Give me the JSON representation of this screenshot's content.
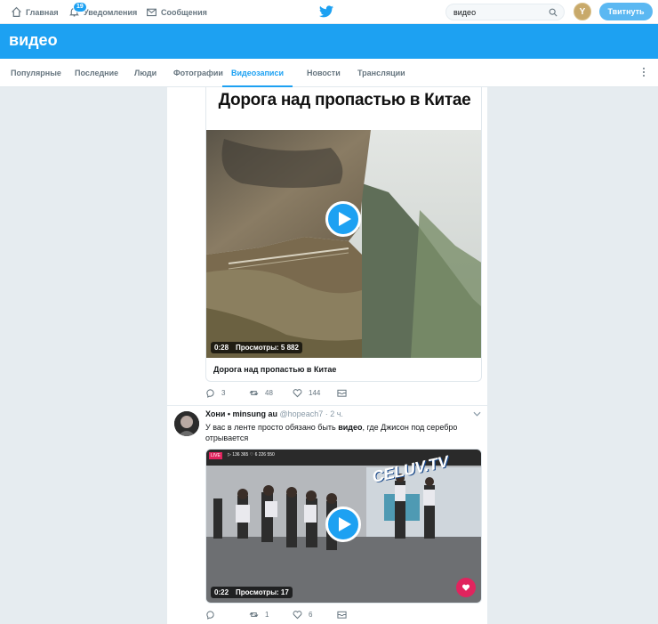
{
  "topnav": {
    "home_label": "Главная",
    "notifications_label": "Уведомления",
    "notifications_count": "19",
    "messages_label": "Сообщения",
    "search_value": "видео",
    "avatar_letter": "Y",
    "tweet_button_label": "Твитнуть"
  },
  "banner": {
    "title": "видео"
  },
  "tabs": [
    {
      "label": "Популярные"
    },
    {
      "label": "Последние"
    },
    {
      "label": "Люди"
    },
    {
      "label": "Фотографии"
    },
    {
      "label": "Видеозаписи",
      "active": true
    },
    {
      "label": "Новости"
    },
    {
      "label": "Трансляции"
    }
  ],
  "tweet1": {
    "card_heading": "Дорога над пропастью в Китае",
    "duration": "0:28",
    "views": "Просмотры: 5 882",
    "caption": "Дорога над пропастью в Китае",
    "replies": "3",
    "retweets": "48",
    "likes": "144"
  },
  "tweet2": {
    "name": "Хони • minsung au",
    "handle": "@hopeach7",
    "time": "· 2 ч.",
    "text_before": "У вас в ленте просто обязано быть ",
    "text_bold": "видео",
    "text_after": ", где Джисон под серебро отрывается",
    "duration": "0:22",
    "views": "Просмотры: 17",
    "overlay_tag": "LIVE",
    "overlay_stats": "▷ 136 365   ♡ 6 226 550",
    "overlay_brand": "CELUV.TV",
    "replies": "",
    "retweets": "1",
    "likes": "6"
  },
  "colors": {
    "accent": "#1da1f2",
    "background": "#e6ecf0"
  }
}
